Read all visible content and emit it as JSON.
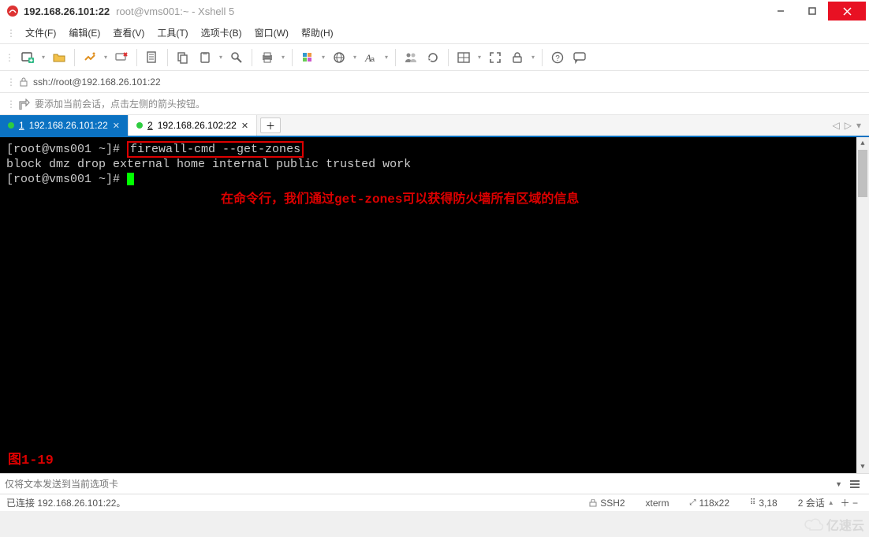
{
  "title": {
    "main": "192.168.26.101:22",
    "sub": "root@vms001:~ - Xshell 5"
  },
  "menu": {
    "file": "文件(F)",
    "edit": "编辑(E)",
    "view": "查看(V)",
    "tools": "工具(T)",
    "tabs": "选项卡(B)",
    "window": "窗口(W)",
    "help": "帮助(H)"
  },
  "addressbar": {
    "url": "ssh://root@192.168.26.101:22"
  },
  "infobar": {
    "tip": "要添加当前会话，点击左侧的箭头按钮。"
  },
  "tabs": [
    {
      "num": "1",
      "label": "192.168.26.101:22",
      "active": true
    },
    {
      "num": "2",
      "label": "192.168.26.102:22",
      "active": false
    }
  ],
  "terminal": {
    "prompt1_pre": "[root@vms001 ~]# ",
    "cmd": "firewall-cmd --get-zones",
    "output": "block dmz drop external home internal public trusted work",
    "prompt2": "[root@vms001 ~]# ",
    "annotation": "在命令行，我们通过get-zones可以获得防火墙所有区域的信息",
    "figure_label": "图1-19"
  },
  "inputbar": {
    "placeholder": "仅将文本发送到当前选项卡"
  },
  "status": {
    "connected": "已连接 192.168.26.101:22。",
    "protocol": "SSH2",
    "termtype": "xterm",
    "size": "118x22",
    "cursor": "3,18",
    "sessions": "2 会话"
  },
  "watermark": "亿速云"
}
